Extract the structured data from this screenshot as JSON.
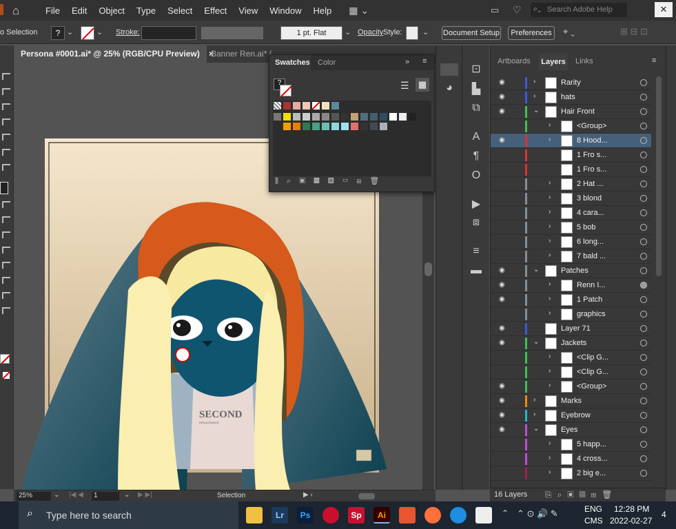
{
  "menubar": {
    "items": [
      "File",
      "Edit",
      "Object",
      "Type",
      "Select",
      "Effect",
      "View",
      "Window",
      "Help"
    ],
    "search_placeholder": "Search Adobe Help"
  },
  "controlbar": {
    "selection_label": "o Selection",
    "stroke_label": "Stroke:",
    "brush_value": "1 pt. Flat",
    "opacity_label": "Opacity",
    "style_label": "Style:",
    "document_setup": "Document Setup",
    "preferences": "Preferences"
  },
  "tabs": [
    {
      "label": "Persona #0001.ai* @ 25% (RGB/CPU Preview)",
      "close": "×"
    },
    {
      "label": "Banner Ren.ai* (",
      "close": ""
    }
  ],
  "status": {
    "zoom": "25%",
    "artboard": "1",
    "mode": "Selection"
  },
  "swatches_panel": {
    "tabs": [
      "Swatches",
      "Color"
    ]
  },
  "artwork": {
    "shirt_text": "SECOND",
    "shirt_subtext": "RENAISSANCE"
  },
  "layers_panel": {
    "tabs": [
      "Artboards",
      "Layers",
      "Links"
    ],
    "count": "16 Layers",
    "rows": [
      {
        "name": "Rarity",
        "indent": 0,
        "visible": true,
        "expand": "›",
        "color": "#3b5bdb"
      },
      {
        "name": "hats",
        "indent": 0,
        "visible": true,
        "expand": "›",
        "color": "#3b5bdb"
      },
      {
        "name": "Hair Front",
        "indent": 0,
        "visible": true,
        "expand": "⌄",
        "color": "#40c057"
      },
      {
        "name": "<Group>",
        "indent": 1,
        "visible": false,
        "expand": "›",
        "color": "#40c057"
      },
      {
        "name": "8 Hood...",
        "indent": 1,
        "visible": true,
        "expand": "›",
        "color": "#e03131",
        "selected": true
      },
      {
        "name": "1 Fro s...",
        "indent": 1,
        "visible": false,
        "expand": "",
        "color": "#e03131"
      },
      {
        "name": "1 Fro s...",
        "indent": 1,
        "visible": false,
        "expand": "",
        "color": "#e03131"
      },
      {
        "name": "2 Hat ...",
        "indent": 1,
        "visible": false,
        "expand": "›",
        "color": "#868e96"
      },
      {
        "name": "3 blond",
        "indent": 1,
        "visible": false,
        "expand": "›",
        "color": "#868e96"
      },
      {
        "name": "4 cara...",
        "indent": 1,
        "visible": false,
        "expand": "›",
        "color": "#868e96"
      },
      {
        "name": "5 bob",
        "indent": 1,
        "visible": false,
        "expand": "›",
        "color": "#868e96"
      },
      {
        "name": "6 long...",
        "indent": 1,
        "visible": false,
        "expand": "›",
        "color": "#868e96"
      },
      {
        "name": "7 bald ...",
        "indent": 1,
        "visible": false,
        "expand": "›",
        "color": "#868e96"
      },
      {
        "name": "Patches",
        "indent": 0,
        "visible": true,
        "expand": "⌄",
        "color": "#868e96"
      },
      {
        "name": "Renn I...",
        "indent": 1,
        "visible": true,
        "expand": "›",
        "color": "#868e96",
        "filled": true
      },
      {
        "name": "1 Patch",
        "indent": 1,
        "visible": true,
        "expand": "›",
        "color": "#868e96"
      },
      {
        "name": "graphics",
        "indent": 1,
        "visible": false,
        "expand": "›",
        "color": "#868e96"
      },
      {
        "name": "Layer 71",
        "indent": 0,
        "visible": true,
        "expand": "",
        "color": "#3b5bdb"
      },
      {
        "name": "Jackets",
        "indent": 0,
        "visible": true,
        "expand": "⌄",
        "color": "#40c057"
      },
      {
        "name": "<Clip G...",
        "indent": 1,
        "visible": false,
        "expand": "›",
        "color": "#40c057"
      },
      {
        "name": "<Clip G...",
        "indent": 1,
        "visible": false,
        "expand": "›",
        "color": "#40c057"
      },
      {
        "name": "<Group>",
        "indent": 1,
        "visible": true,
        "expand": "›",
        "color": "#40c057"
      },
      {
        "name": "Marks",
        "indent": 0,
        "visible": true,
        "expand": "›",
        "color": "#f08c00"
      },
      {
        "name": "Eyebrow",
        "indent": 0,
        "visible": true,
        "expand": "›",
        "color": "#22b8cf"
      },
      {
        "name": "Eyes",
        "indent": 0,
        "visible": true,
        "expand": "⌄",
        "color": "#be4bdb"
      },
      {
        "name": "5 happ...",
        "indent": 1,
        "visible": false,
        "expand": "›",
        "color": "#be4bdb"
      },
      {
        "name": "4 cross...",
        "indent": 1,
        "visible": false,
        "expand": "›",
        "color": "#be4bdb"
      },
      {
        "name": "2 big e...",
        "indent": 1,
        "visible": false,
        "expand": "›",
        "color": "#a61e4d"
      }
    ]
  },
  "taskbar": {
    "search_placeholder": "Type here to search",
    "lang1": "ENG",
    "lang2": "CMS",
    "time": "12:28 PM",
    "date": "2022-02-27",
    "notifications": "4",
    "apps": [
      {
        "label": "Lr",
        "color": "#1b3a5c",
        "text": "#9ecbff"
      },
      {
        "label": "Ps",
        "color": "#0b1f3a",
        "text": "#31a8ff"
      },
      {
        "label": "Sp",
        "color": "#c8102e",
        "text": "#fff"
      },
      {
        "label": "Ai",
        "color": "#330000",
        "text": "#ff9a00"
      }
    ]
  }
}
